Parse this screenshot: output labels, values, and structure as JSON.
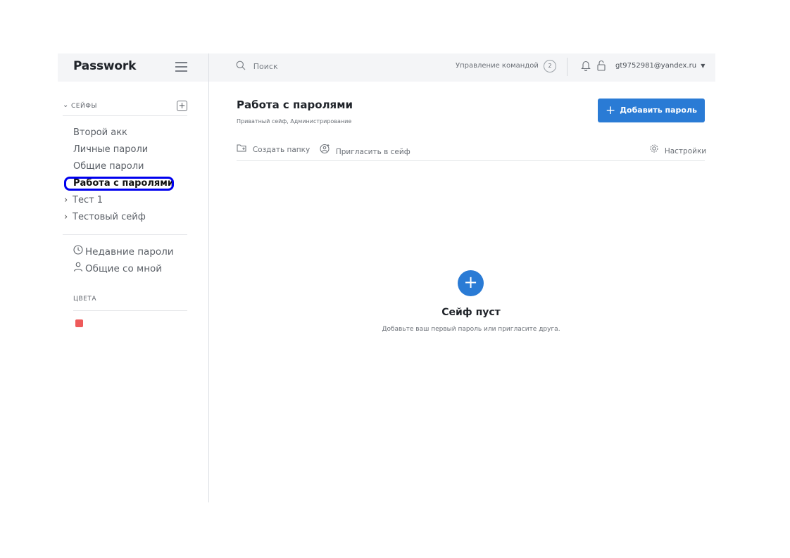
{
  "app": {
    "logo": "Passwork"
  },
  "sidebar": {
    "vaults_title": "СЕЙФЫ",
    "vaults": [
      {
        "label": "Второй акк"
      },
      {
        "label": "Личные пароли"
      },
      {
        "label": "Общие пароли"
      },
      {
        "label": "Работа с паролями",
        "active": true
      },
      {
        "label": "Тест 1",
        "expandable": true
      },
      {
        "label": "Тестовый сейф",
        "expandable": true
      }
    ],
    "recent_label": "Недавние пароли",
    "shared_label": "Общие со мной",
    "colors_title": "ЦВЕТА",
    "color_swatch": "#ee5a5a"
  },
  "topbar": {
    "search_placeholder": "Поиск",
    "team_label": "Управление командой",
    "team_count": "2",
    "user_email": "gt9752981@yandex.ru"
  },
  "main": {
    "vault_title": "Работа с паролями",
    "vault_subtitle": "Приватный сейф, Администрирование",
    "add_password_label": "Добавить пароль",
    "create_folder_label": "Создать папку",
    "invite_label": "Пригласить в сейф",
    "settings_label": "Настройки",
    "empty_title": "Сейф пуст",
    "empty_subtitle": "Добавьте ваш первый пароль или пригласите друга."
  },
  "colors": {
    "accent": "#2a7bd5",
    "highlight": "#0000ee"
  }
}
